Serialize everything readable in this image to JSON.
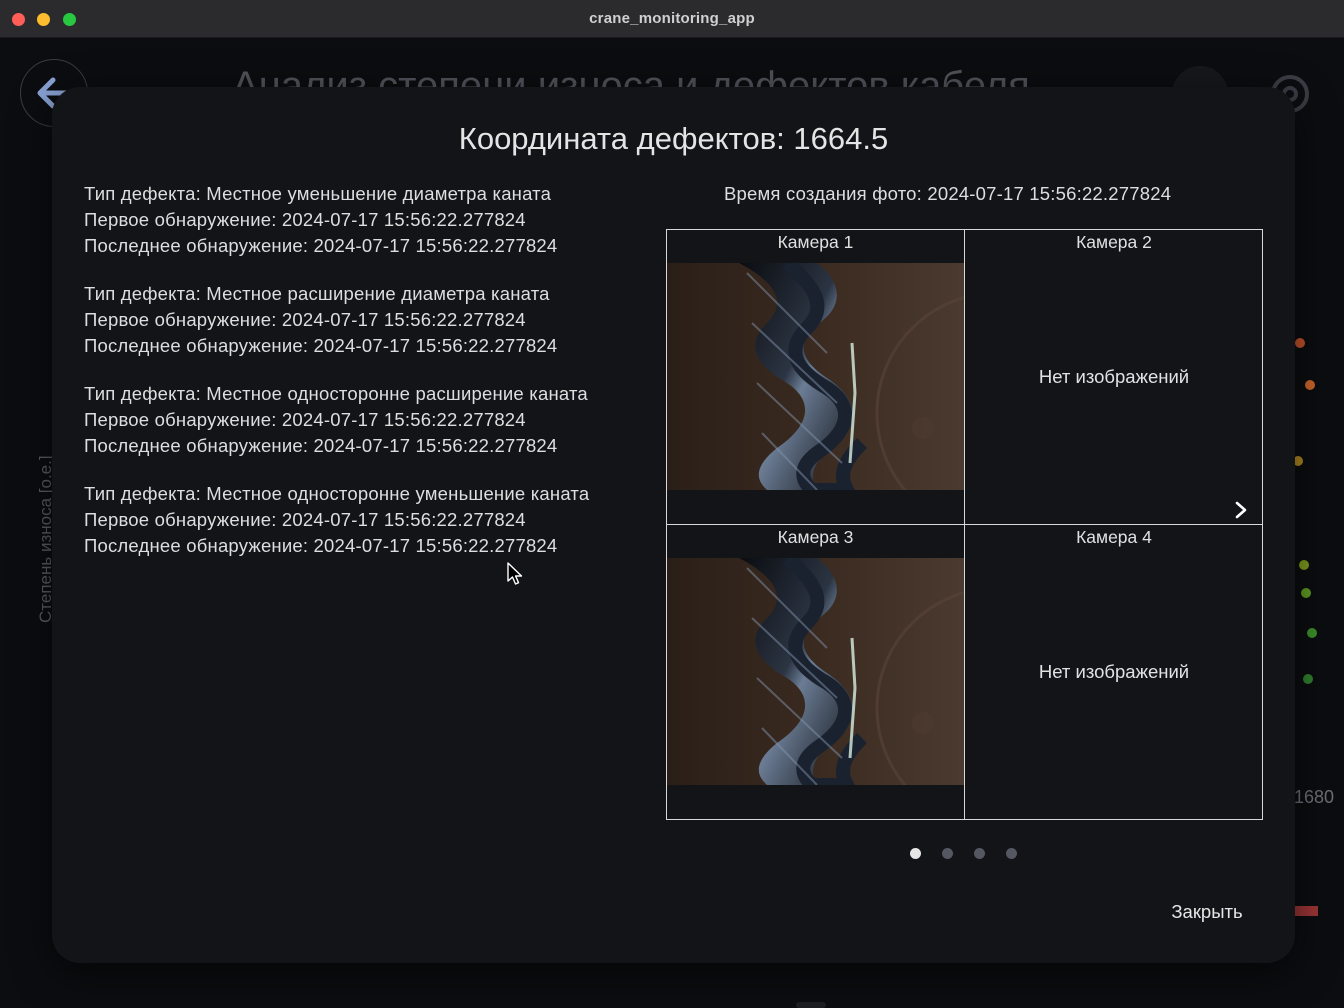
{
  "window": {
    "title": "crane_monitoring_app"
  },
  "background": {
    "title": "Анализ степени износа и дефектов кабеля",
    "y_axis_label": "Степень износа [о.е.]",
    "x_tick": "1680",
    "back_icon": "arrow-left-icon",
    "settings_icon": "settings-icon"
  },
  "dialog": {
    "title": "Координата дефектов: 1664.5",
    "photo_time": "Время создания фото: 2024-07-17 15:56:22.277824",
    "defects": [
      {
        "type": "Тип дефекта: Местное уменьшение диаметра каната",
        "first": "Первое обнаружение: 2024-07-17 15:56:22.277824",
        "last": "Последнее обнаружение: 2024-07-17 15:56:22.277824"
      },
      {
        "type": "Тип дефекта: Местное расширение диаметра каната",
        "first": "Первое обнаружение: 2024-07-17 15:56:22.277824",
        "last": "Последнее обнаружение: 2024-07-17 15:56:22.277824"
      },
      {
        "type": "Тип дефекта: Местное односторонне расширение каната",
        "first": "Первое обнаружение: 2024-07-17 15:56:22.277824",
        "last": "Последнее обнаружение: 2024-07-17 15:56:22.277824"
      },
      {
        "type": "Тип дефекта: Местное односторонне уменьшение каната",
        "first": "Первое обнаружение: 2024-07-17 15:56:22.277824",
        "last": "Последнее обнаружение: 2024-07-17 15:56:22.277824"
      }
    ],
    "cameras": [
      {
        "label": "Камера 1",
        "has_image": true
      },
      {
        "label": "Камера 2",
        "no_image_text": "Нет изображений"
      },
      {
        "label": "Камера 3",
        "has_image": true
      },
      {
        "label": "Камера 4",
        "no_image_text": "Нет изображений"
      }
    ],
    "pagination": {
      "pages": 4,
      "current": 1
    },
    "close_label": "Закрыть",
    "next_icon": "chevron-right-icon"
  }
}
